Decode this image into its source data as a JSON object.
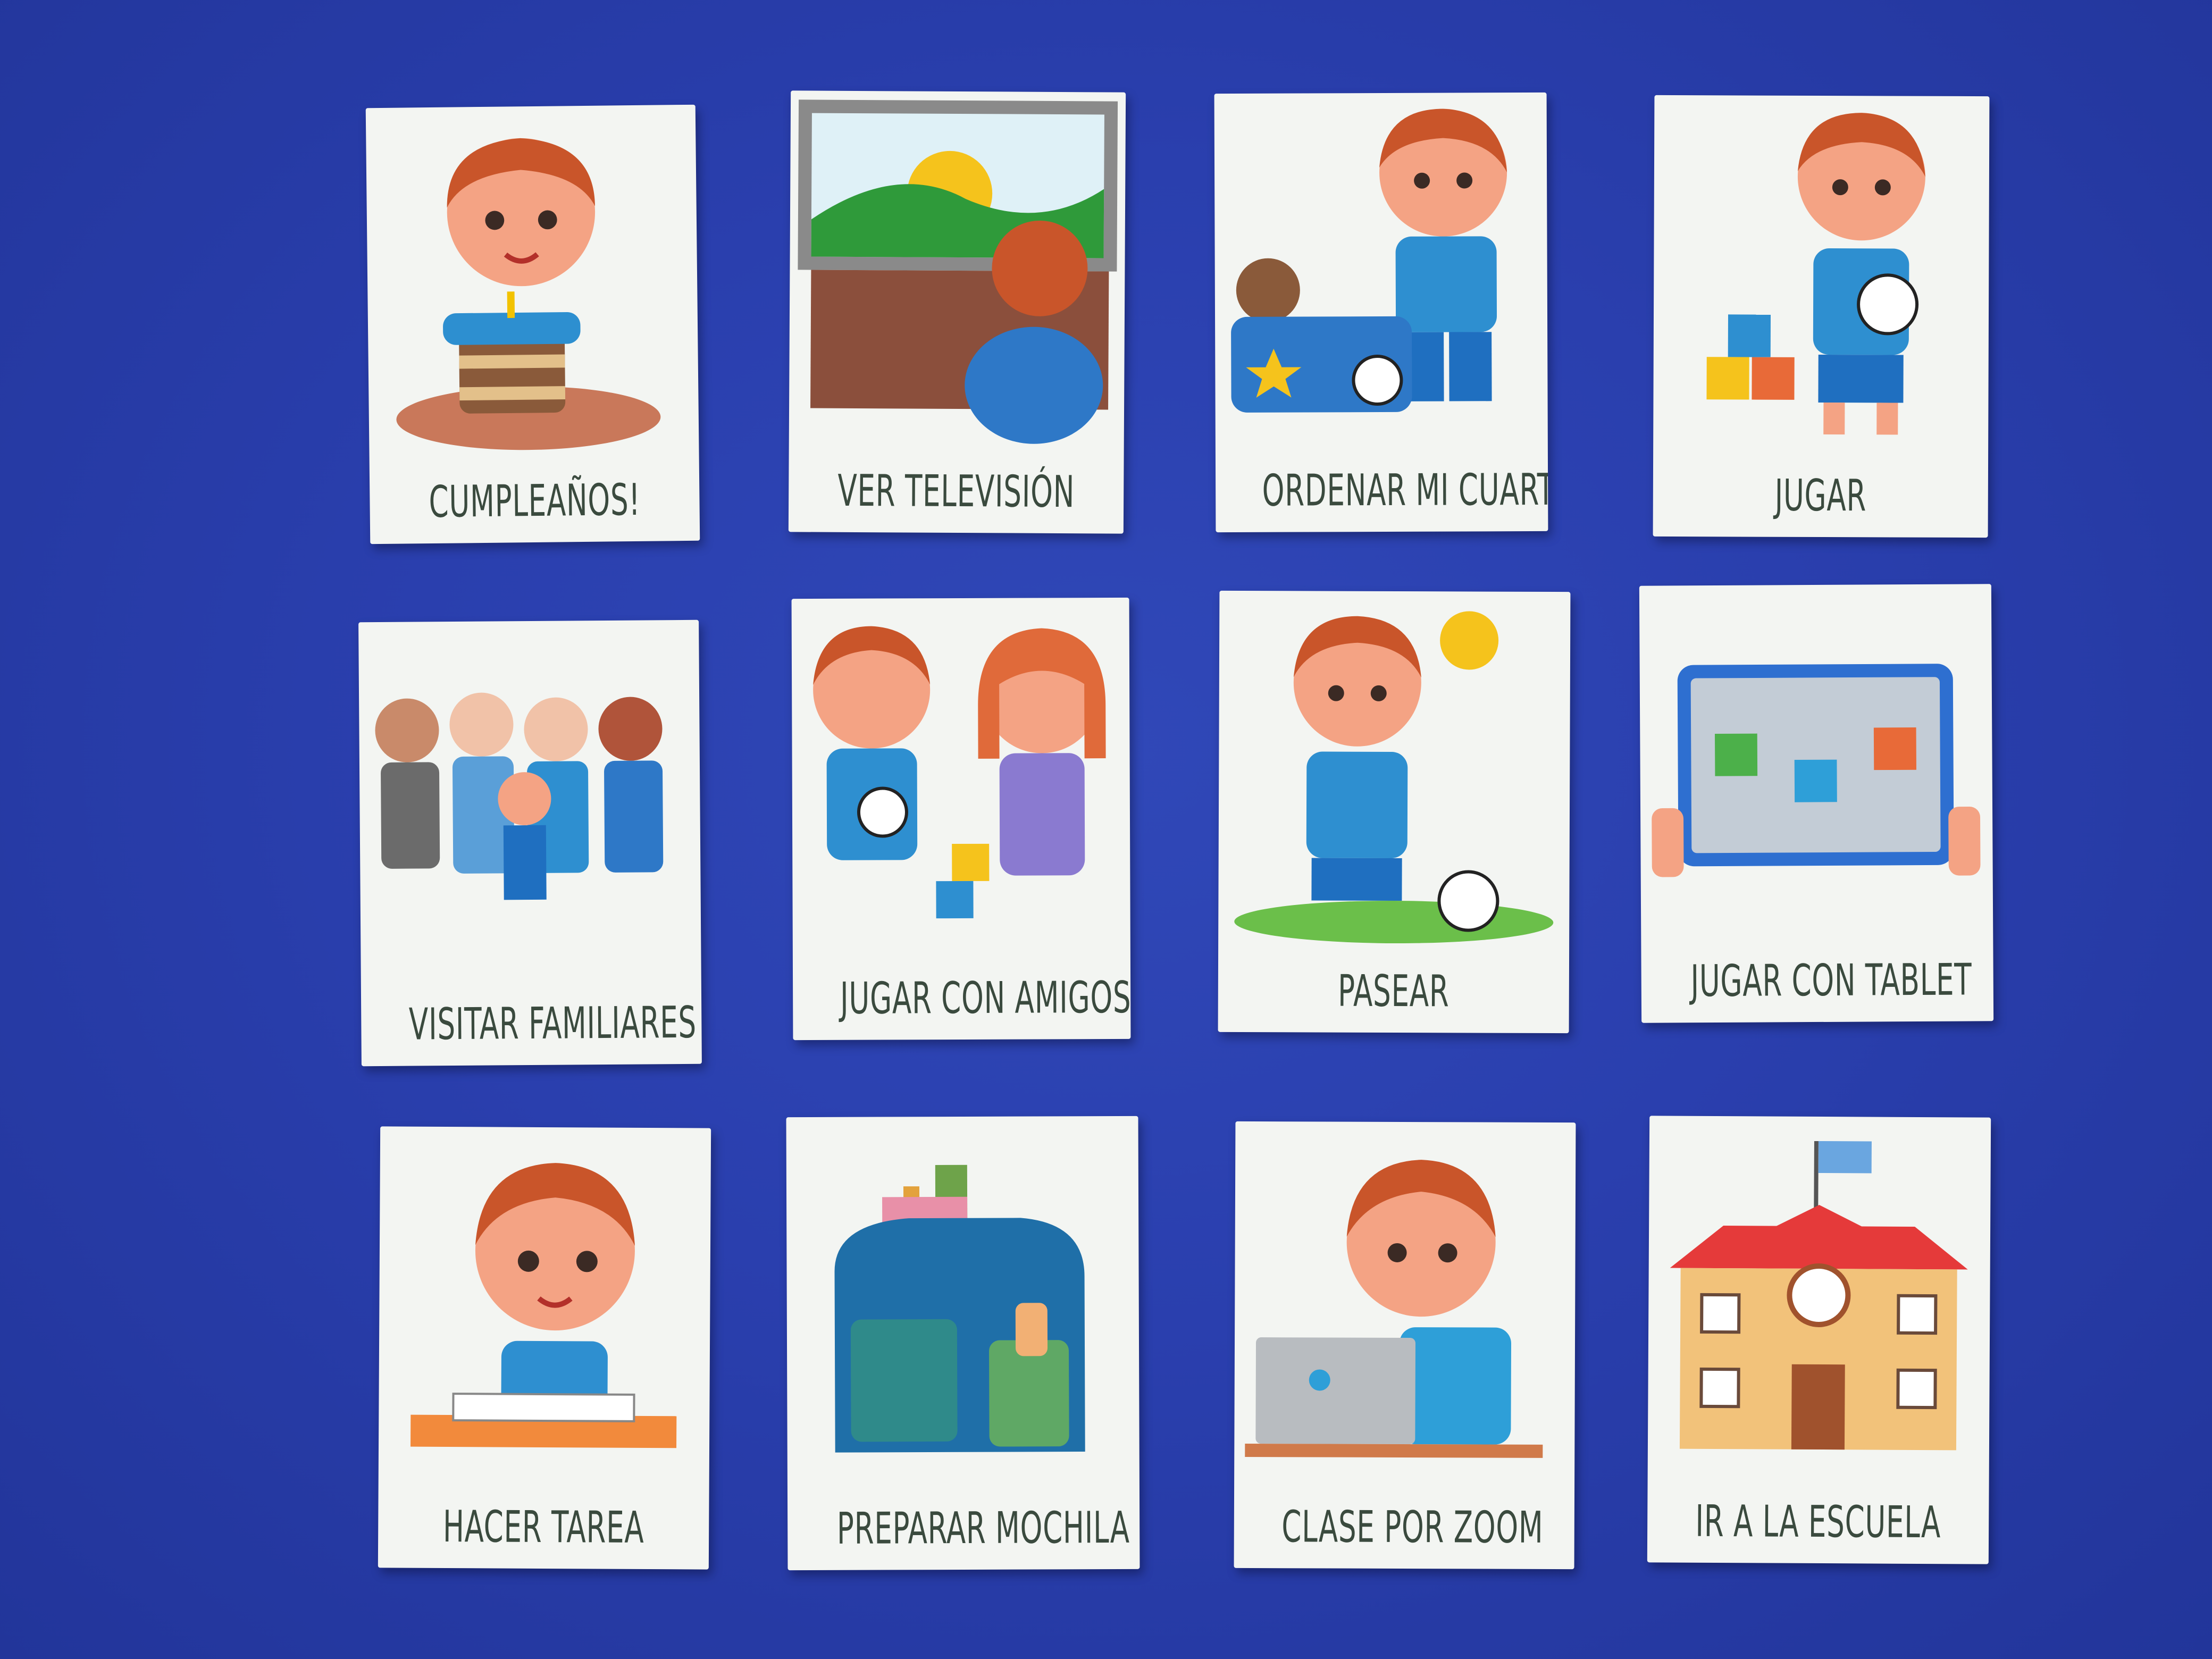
{
  "background_color": "#2a3fae",
  "card_color": "#f3f5f2",
  "cards": [
    {
      "label": "Cumpleaños!",
      "icon": "birthday-cake-boy-icon"
    },
    {
      "label": "Ver televisión",
      "icon": "tv-watching-icon"
    },
    {
      "label": "Ordenar mi cuarto",
      "icon": "toy-box-icon"
    },
    {
      "label": "Jugar",
      "icon": "boy-ball-blocks-icon"
    },
    {
      "label": "Visitar familiares",
      "icon": "family-icon"
    },
    {
      "label": "Jugar con amigos",
      "icon": "kids-playing-icon"
    },
    {
      "label": "Pasear",
      "icon": "boy-outdoor-sun-icon"
    },
    {
      "label": "Jugar con tablet",
      "icon": "tablet-icon"
    },
    {
      "label": "Hacer tarea",
      "icon": "boy-homework-icon"
    },
    {
      "label": "Preparar mochila",
      "icon": "backpack-icon"
    },
    {
      "label": "Clase por ZOOM",
      "icon": "laptop-class-icon"
    },
    {
      "label": "Ir a la escuela",
      "icon": "school-building-icon"
    }
  ]
}
